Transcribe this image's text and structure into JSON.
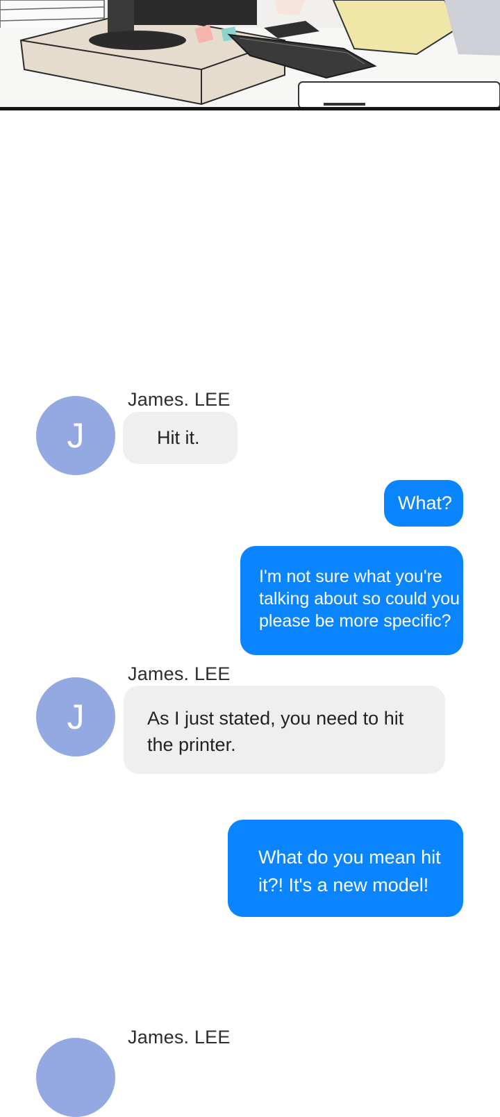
{
  "panel": {
    "colors": {
      "border": "#151515",
      "desk": "#e6dccd",
      "monitor": "#2b2b2b",
      "shirt": "#efe6a7"
    },
    "icons": [
      "monitor-illustration",
      "keyboard-illustration"
    ]
  },
  "chat": {
    "colors": {
      "incoming": "#efefef",
      "outgoing": "#0a84ff",
      "avatar": "#94a9e2"
    },
    "messages": [
      {
        "sender": "James. LEE",
        "avatar_letter": "J",
        "text": "Hit it.",
        "direction": "in"
      },
      {
        "text": "What?",
        "direction": "out"
      },
      {
        "text": "I'm not sure what you're\ntalking about so could you\nplease be more specific?",
        "direction": "out"
      },
      {
        "sender": "James. LEE",
        "avatar_letter": "J",
        "text": "As I just stated, you need to hit\nthe printer.",
        "direction": "in"
      },
      {
        "text": "What do you mean hit\nit?! It's a new model!",
        "direction": "out"
      },
      {
        "sender": "James. LEE",
        "direction": "in"
      }
    ]
  }
}
